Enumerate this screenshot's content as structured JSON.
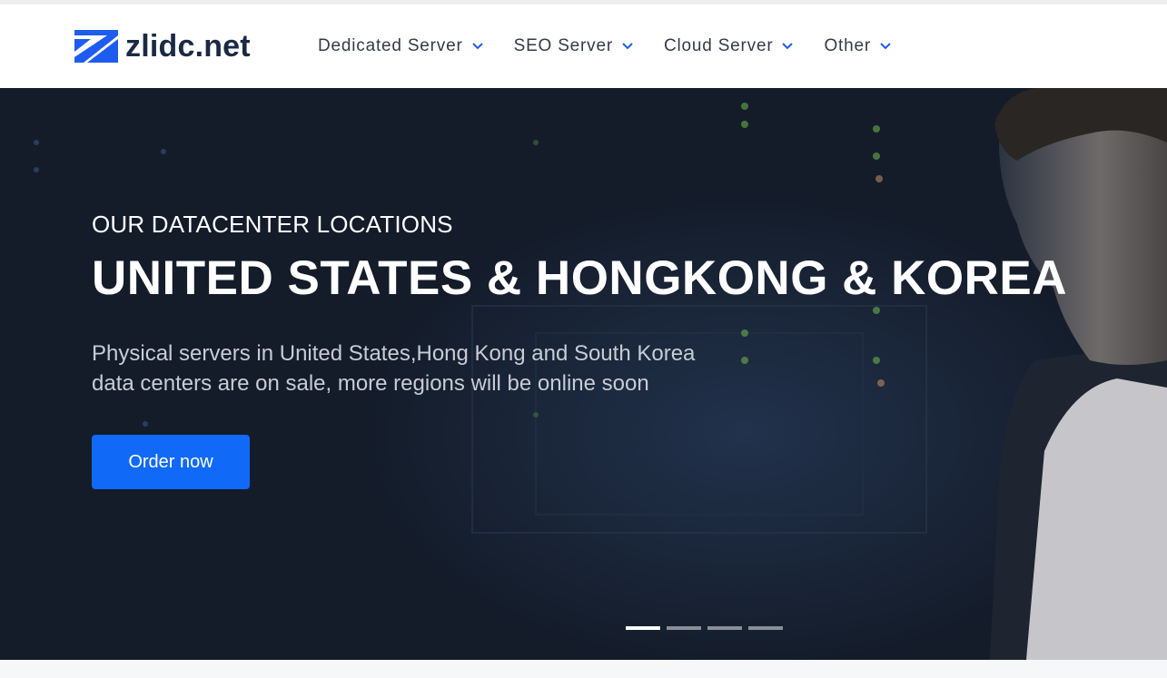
{
  "brand": {
    "name": "zlidc.net",
    "logo_icon": "z-logo-icon",
    "accent": "#1e5cf0"
  },
  "nav": {
    "items": [
      {
        "label": "Dedicated Server"
      },
      {
        "label": "SEO Server"
      },
      {
        "label": "Cloud Server"
      },
      {
        "label": "Other"
      }
    ]
  },
  "hero": {
    "eyebrow": "OUR DATACENTER LOCATIONS",
    "headline": "UNITED STATES & HONGKONG & KOREA",
    "description_line1": "Physical servers in United States,Hong Kong and South Korea",
    "description_line2": "data centers are on sale, more regions will be online soon",
    "cta_label": "Order now",
    "cta_color": "#1169f7"
  },
  "carousel": {
    "slide_count": 4,
    "active_index": 0
  }
}
